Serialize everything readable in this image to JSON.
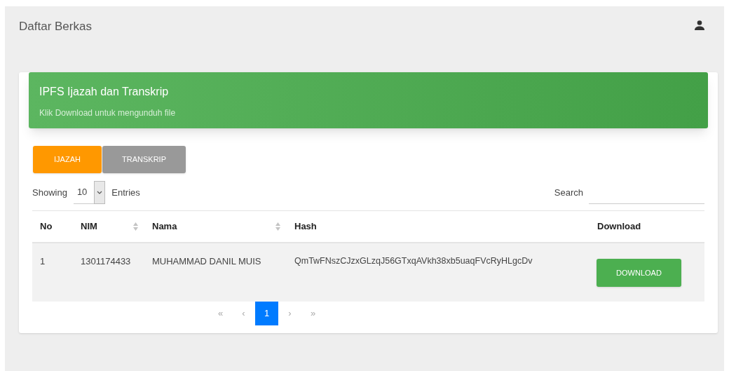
{
  "page": {
    "title": "Daftar Berkas"
  },
  "banner": {
    "title": "IPFS Ijazah dan Transkrip",
    "subtitle": "Klik Download untuk mengunduh file"
  },
  "tabs": [
    {
      "label": "IJAZAH",
      "selected": true
    },
    {
      "label": "TRANSKRIP",
      "selected": false
    }
  ],
  "length": {
    "prefix": "Showing",
    "value": "10",
    "suffix": "Entries"
  },
  "search": {
    "label": "Search"
  },
  "table": {
    "columns": [
      {
        "label": "No",
        "sortable": false
      },
      {
        "label": "NIM",
        "sortable": true
      },
      {
        "label": "Nama",
        "sortable": true
      },
      {
        "label": "Hash",
        "sortable": false
      },
      {
        "label": "Download",
        "sortable": false
      }
    ],
    "rows": [
      {
        "no": "1",
        "nim": "1301174433",
        "nama": "MUHAMMAD DANIL MUIS",
        "hash": "QmTwFNszCJzxGLzqJ56GTxqAVkh38xb5uaqFVcRyHLgcDv",
        "action": "DOWNLOAD"
      }
    ]
  },
  "pagination": [
    {
      "label": "«",
      "selected": false
    },
    {
      "label": "‹",
      "selected": false
    },
    {
      "label": "1",
      "selected": true
    },
    {
      "label": "›",
      "selected": false
    },
    {
      "label": "»",
      "selected": false
    }
  ]
}
